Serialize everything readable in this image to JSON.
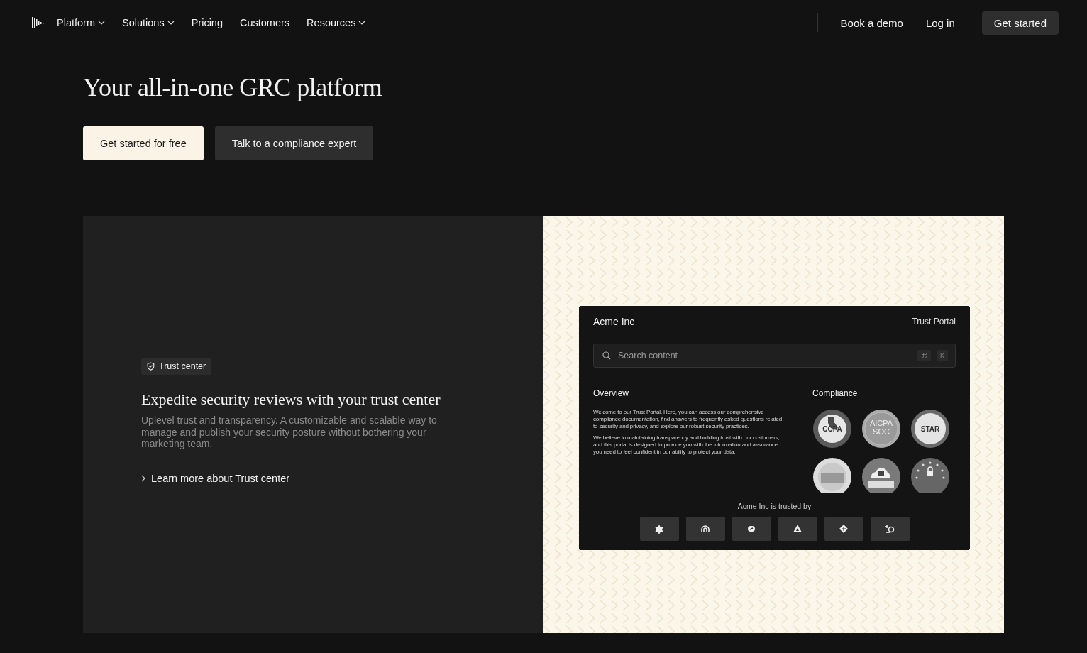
{
  "nav": {
    "items": [
      {
        "label": "Platform",
        "dropdown": true
      },
      {
        "label": "Solutions",
        "dropdown": true
      },
      {
        "label": "Pricing",
        "dropdown": false
      },
      {
        "label": "Customers",
        "dropdown": false
      },
      {
        "label": "Resources",
        "dropdown": true
      }
    ],
    "actions": [
      {
        "label": "Book a demo",
        "kind": "link"
      },
      {
        "label": "Log in",
        "kind": "link"
      },
      {
        "label": "Get started",
        "kind": "button"
      }
    ]
  },
  "hero": {
    "title": "Your all-in-one GRC platform",
    "buttons": [
      {
        "label": "Get started for free",
        "kind": "primary"
      },
      {
        "label": "Talk to a compliance expert",
        "kind": "secondary"
      }
    ]
  },
  "feature": {
    "tag": "Trust center",
    "heading": "Expedite security reviews with your trust center",
    "description": "Uplevel trust and transparency. A customizable and scalable way to manage and publish your security posture without bothering your marketing team.",
    "link": "Learn more about Trust center",
    "portal": {
      "company": "Acme Inc",
      "title": "Trust Portal",
      "search": {
        "placeholder": "Search content",
        "keys": [
          "⌘",
          "K"
        ]
      },
      "overview": {
        "heading": "Overview",
        "paragraphs": [
          "Welcome to our Trust Portal. Here, you can access our comprehensive compliance documentation, find answers to frequently asked questions related to security and privacy, and explore our robust security practices.",
          "We believe in maintaining transparency and building trust with our customers, and this portal is designed to provide you with the information and assurance you need to feel confident in our ability to protect your data."
        ]
      },
      "compliance": {
        "heading": "Compliance",
        "badges": [
          {
            "kind": "ccpa",
            "lines": [
              "CCPA"
            ]
          },
          {
            "kind": "aicpa",
            "lines": [
              "AICPA",
              "SOC"
            ]
          },
          {
            "kind": "star",
            "lines": [
              "STAR"
            ]
          },
          {
            "kind": "iso"
          },
          {
            "kind": "cloud"
          },
          {
            "kind": "stars"
          }
        ]
      },
      "trusted": {
        "label": "Acme Inc is trusted by",
        "logos": [
          {
            "kind": "burst"
          },
          {
            "kind": "arch"
          },
          {
            "kind": "loop"
          },
          {
            "kind": "triangle"
          },
          {
            "kind": "diamond"
          },
          {
            "kind": "spark"
          }
        ]
      }
    }
  }
}
